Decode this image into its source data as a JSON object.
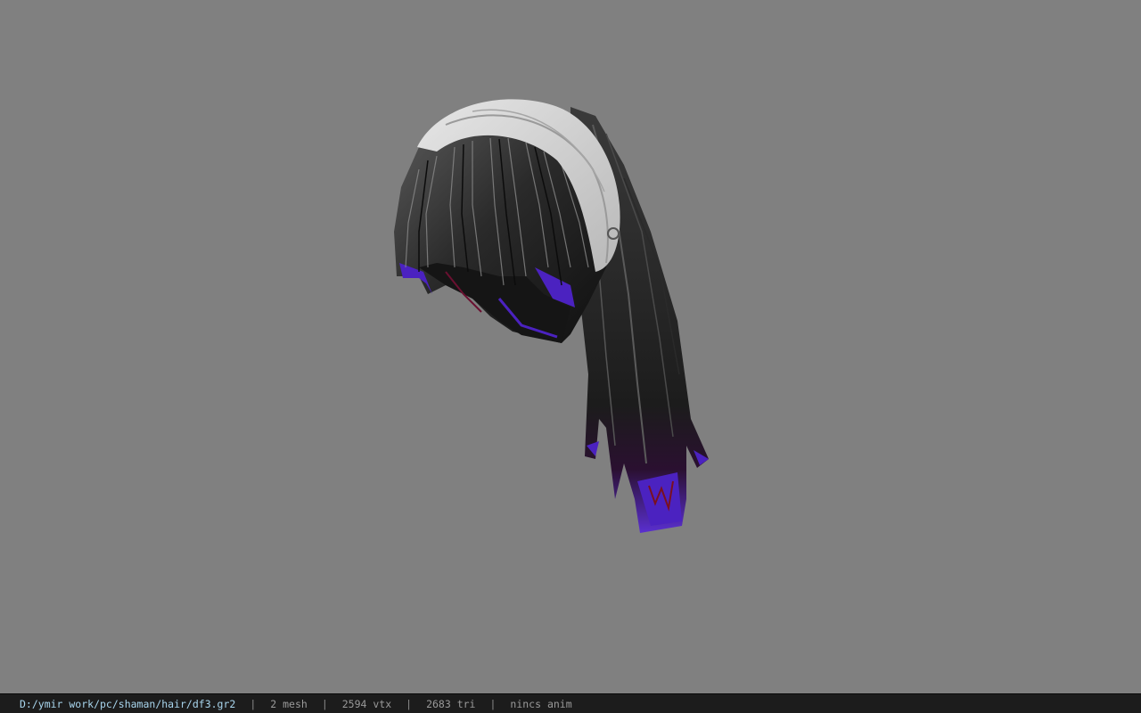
{
  "status": {
    "file_path": "D:/ymir work/pc/shaman/hair/df3.gr2",
    "separator": "|",
    "mesh": "2 mesh",
    "vertices": "2594 vtx",
    "triangles": "2683 tri",
    "animation": "nincs anim"
  },
  "colors": {
    "viewport_bg": "#808080",
    "statusbar_bg": "#1c1c1c",
    "path_text": "#a9d6ee",
    "status_text": "#9a9a9a",
    "hair_dark": "#1e1e1e",
    "hair_tips": "#5a2fd0",
    "hair_tips_red": "#7a1020",
    "headband": "#d8d8d8"
  },
  "model": {
    "name_icon": "hair-model-icon"
  }
}
